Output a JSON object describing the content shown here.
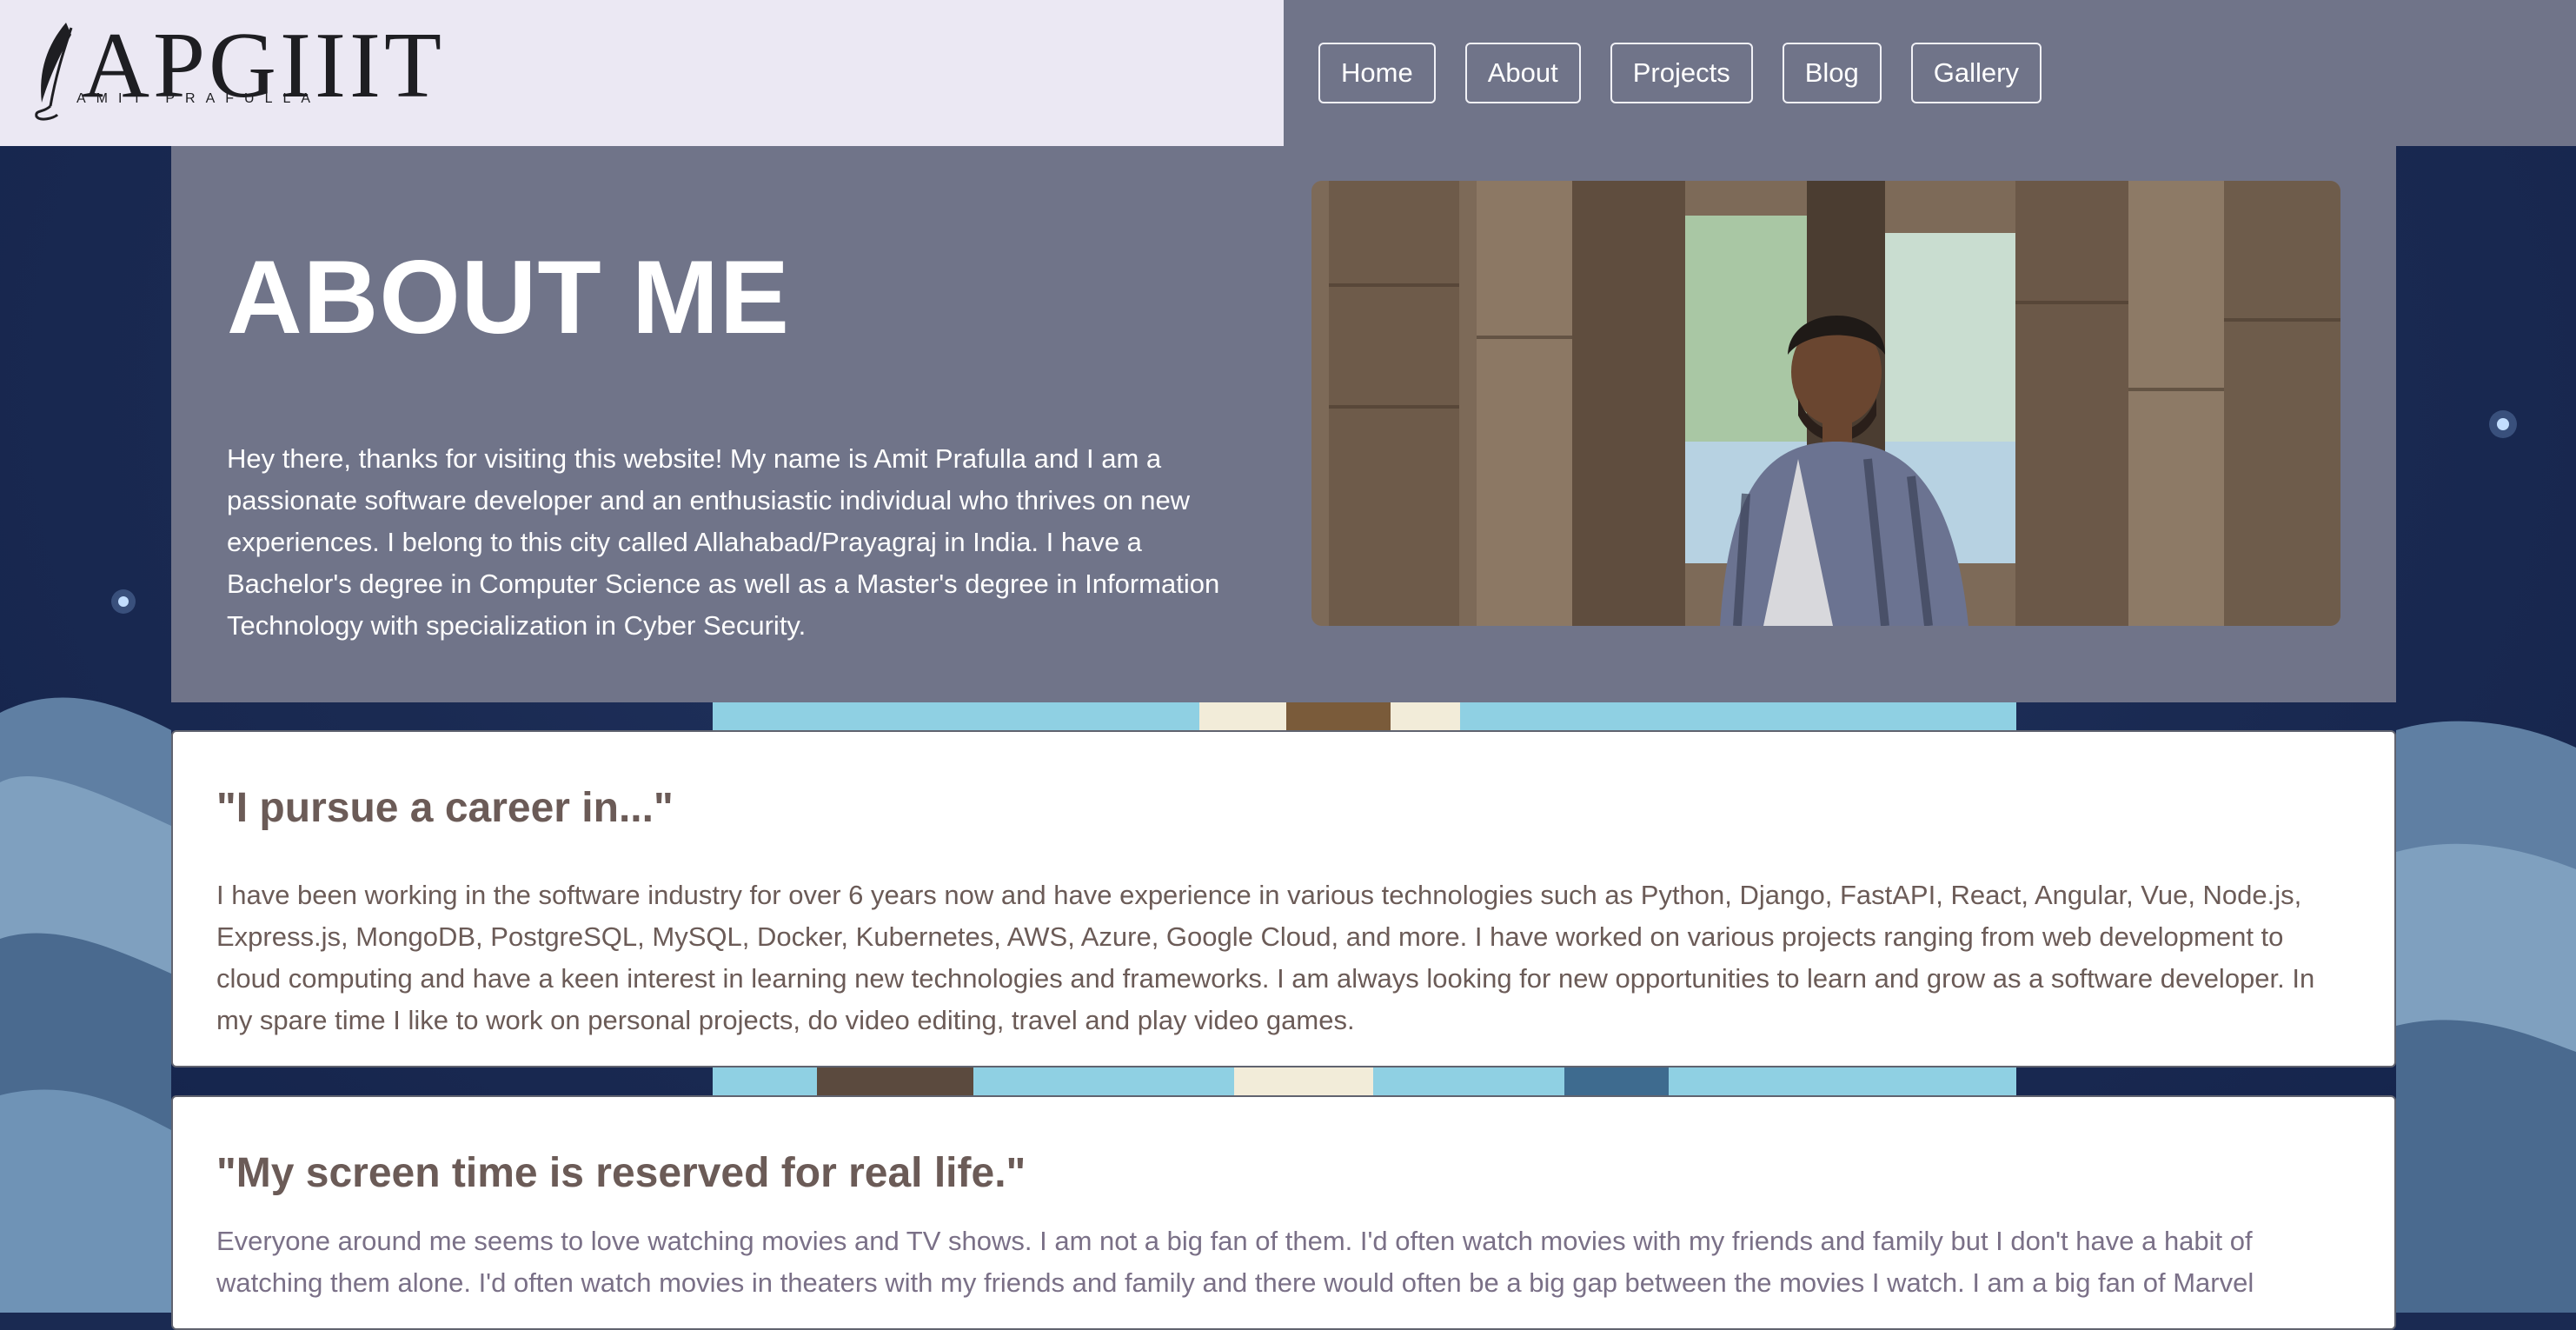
{
  "brand": {
    "logo_text": "APGIIIT",
    "logo_subtitle": "AMIT PRAFULLA"
  },
  "nav": {
    "items": [
      {
        "label": "Home"
      },
      {
        "label": "About"
      },
      {
        "label": "Projects"
      },
      {
        "label": "Blog"
      },
      {
        "label": "Gallery"
      }
    ]
  },
  "about": {
    "title": "ABOUT ME",
    "text": "Hey there, thanks for visiting this website! My name is Amit Prafulla and I am a passionate software developer and an enthusiastic individual who thrives on new experiences. I belong to this city called Allahabad/Prayagraj in India. I have a Bachelor's degree in Computer Science as well as a Master's degree in Information Technology with specialization in Cyber Security."
  },
  "cards": [
    {
      "heading": "\"I pursue a career in...\"",
      "body": "I have been working in the software industry for over 6 years now and have experience in various technologies such as Python, Django, FastAPI, React, Angular, Vue, Node.js, Express.js, MongoDB, PostgreSQL, MySQL, Docker, Kubernetes, AWS, Azure, Google Cloud, and more. I have worked on various projects ranging from web development to cloud computing and have a keen interest in learning new technologies and frameworks. I am always looking for new opportunities to learn and grow as a software developer. In my spare time I like to work on personal projects, do video editing, travel and play video games."
    },
    {
      "heading": "\"My screen time is reserved for real life.\"",
      "body": "Everyone around me seems to love watching movies and TV shows. I am not a big fan of them. I'd often watch movies with my friends and family but I don't have a habit of watching them alone. I'd often watch movies in theaters with my friends and family and there would often be a big gap between the movies I watch. I am a big fan of Marvel"
    }
  ],
  "colors": {
    "brand_bg": "#ebe8f3",
    "nav_bg": "#707489",
    "page_bg": "#1a2a52",
    "card_text": "#6b5b57"
  },
  "icons": {
    "logo": "quill-icon"
  }
}
